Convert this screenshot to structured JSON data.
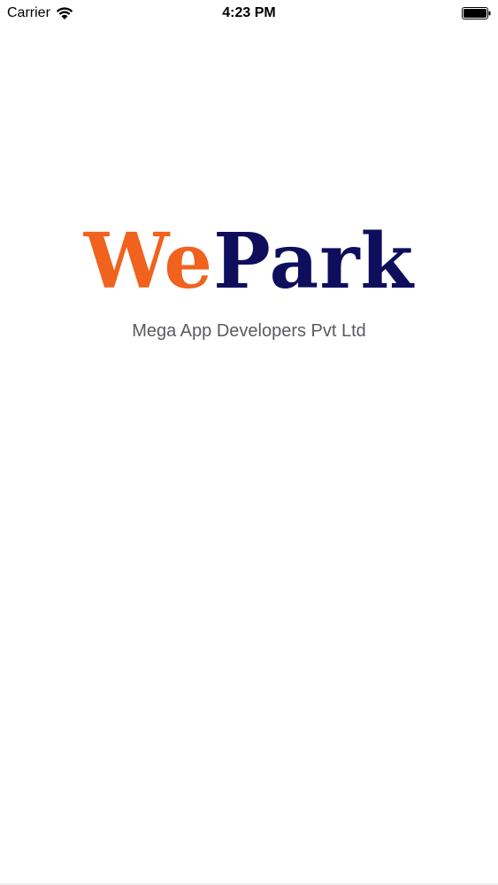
{
  "status_bar": {
    "carrier": "Carrier",
    "time": "4:23 PM",
    "wifi_icon": "wifi-icon",
    "battery_icon": "battery-icon",
    "battery_level": 1.0
  },
  "splash": {
    "logo_part1": "We",
    "logo_part2": "Park",
    "logo_part1_color": "#f0621d",
    "logo_part2_color": "#0f0e5c",
    "subtitle": "Mega App Developers Pvt Ltd"
  }
}
